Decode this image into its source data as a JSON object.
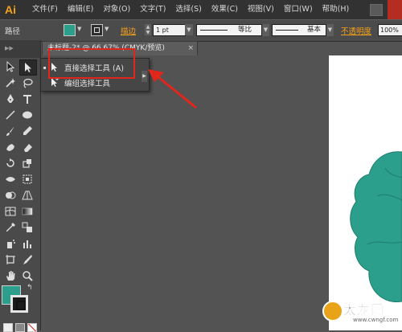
{
  "app": {
    "logo": "Ai"
  },
  "menu": {
    "items": [
      {
        "label": "文件(F)"
      },
      {
        "label": "编辑(E)"
      },
      {
        "label": "对象(O)"
      },
      {
        "label": "文字(T)"
      },
      {
        "label": "选择(S)"
      },
      {
        "label": "效果(C)"
      },
      {
        "label": "视图(V)"
      },
      {
        "label": "窗口(W)"
      },
      {
        "label": "帮助(H)"
      }
    ]
  },
  "control_bar": {
    "selection_type": "路径",
    "fill_color": "#2b9f8c",
    "stroke_label": "描边",
    "stroke_weight": "1 pt",
    "variable_width_profile": "等比",
    "brush_definition": "基本",
    "opacity_label": "不透明度",
    "opacity_value": "100%"
  },
  "document_tab": {
    "title": "未标题-2* @ 66.67% (CMYK/预览)",
    "close": "×"
  },
  "tool_flyout": {
    "items": [
      {
        "label": "直接选择工具  (A)",
        "icon": "direct-selection-icon"
      },
      {
        "label": "编组选择工具",
        "icon": "group-selection-icon"
      }
    ]
  },
  "tools": [
    {
      "name": "selection-tool-icon"
    },
    {
      "name": "direct-selection-tool-icon",
      "active": true
    },
    {
      "name": "magic-wand-tool-icon"
    },
    {
      "name": "lasso-tool-icon"
    },
    {
      "name": "pen-tool-icon"
    },
    {
      "name": "type-tool-icon"
    },
    {
      "name": "line-segment-tool-icon"
    },
    {
      "name": "ellipse-tool-icon"
    },
    {
      "name": "paintbrush-tool-icon"
    },
    {
      "name": "pencil-tool-icon"
    },
    {
      "name": "blob-brush-tool-icon"
    },
    {
      "name": "eraser-tool-icon"
    },
    {
      "name": "rotate-tool-icon"
    },
    {
      "name": "scale-tool-icon"
    },
    {
      "name": "width-tool-icon"
    },
    {
      "name": "free-transform-tool-icon"
    },
    {
      "name": "shape-builder-tool-icon"
    },
    {
      "name": "perspective-grid-tool-icon"
    },
    {
      "name": "mesh-tool-icon"
    },
    {
      "name": "gradient-tool-icon"
    },
    {
      "name": "eyedropper-tool-icon"
    },
    {
      "name": "blend-tool-icon"
    },
    {
      "name": "symbol-sprayer-tool-icon"
    },
    {
      "name": "column-graph-tool-icon"
    },
    {
      "name": "artboard-tool-icon"
    },
    {
      "name": "slice-tool-icon"
    },
    {
      "name": "hand-tool-icon"
    },
    {
      "name": "zoom-tool-icon"
    }
  ],
  "colors": {
    "accent_orange": "#f7a21b",
    "annotation_red": "#e1261c",
    "teal_fill": "#2b9f8c"
  },
  "watermark": {
    "text": "太龙网",
    "url": "www.cwngf.com"
  }
}
